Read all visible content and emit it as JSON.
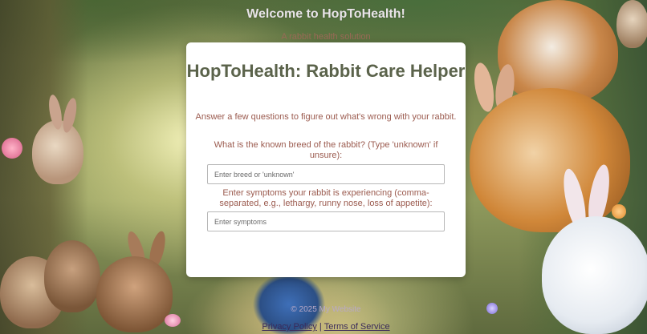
{
  "header": {
    "title": "Welcome to HopToHealth!",
    "tagline": "A rabbit health solution"
  },
  "card": {
    "title": "HopToHealth: Rabbit Care Helper",
    "subtitle": "Answer a few questions to figure out what's wrong with your rabbit.",
    "breed_question": "What is the known breed of the rabbit? (Type 'unknown' if unsure):",
    "breed_placeholder": "Enter breed or 'unknown'",
    "symptoms_question": "Enter symptoms your rabbit is experiencing (comma-separated, e.g., lethargy, runny nose, loss of appetite):",
    "symptoms_placeholder": "Enter symptoms"
  },
  "footer": {
    "copyright": "© 2025 My Website",
    "links": [
      "Privacy Policy",
      "Terms of Service"
    ],
    "separator": "|"
  },
  "colors": {
    "card_title": "#5b634b",
    "question_text": "#9b5b4f",
    "scroll_accent": "#4cae4c"
  }
}
